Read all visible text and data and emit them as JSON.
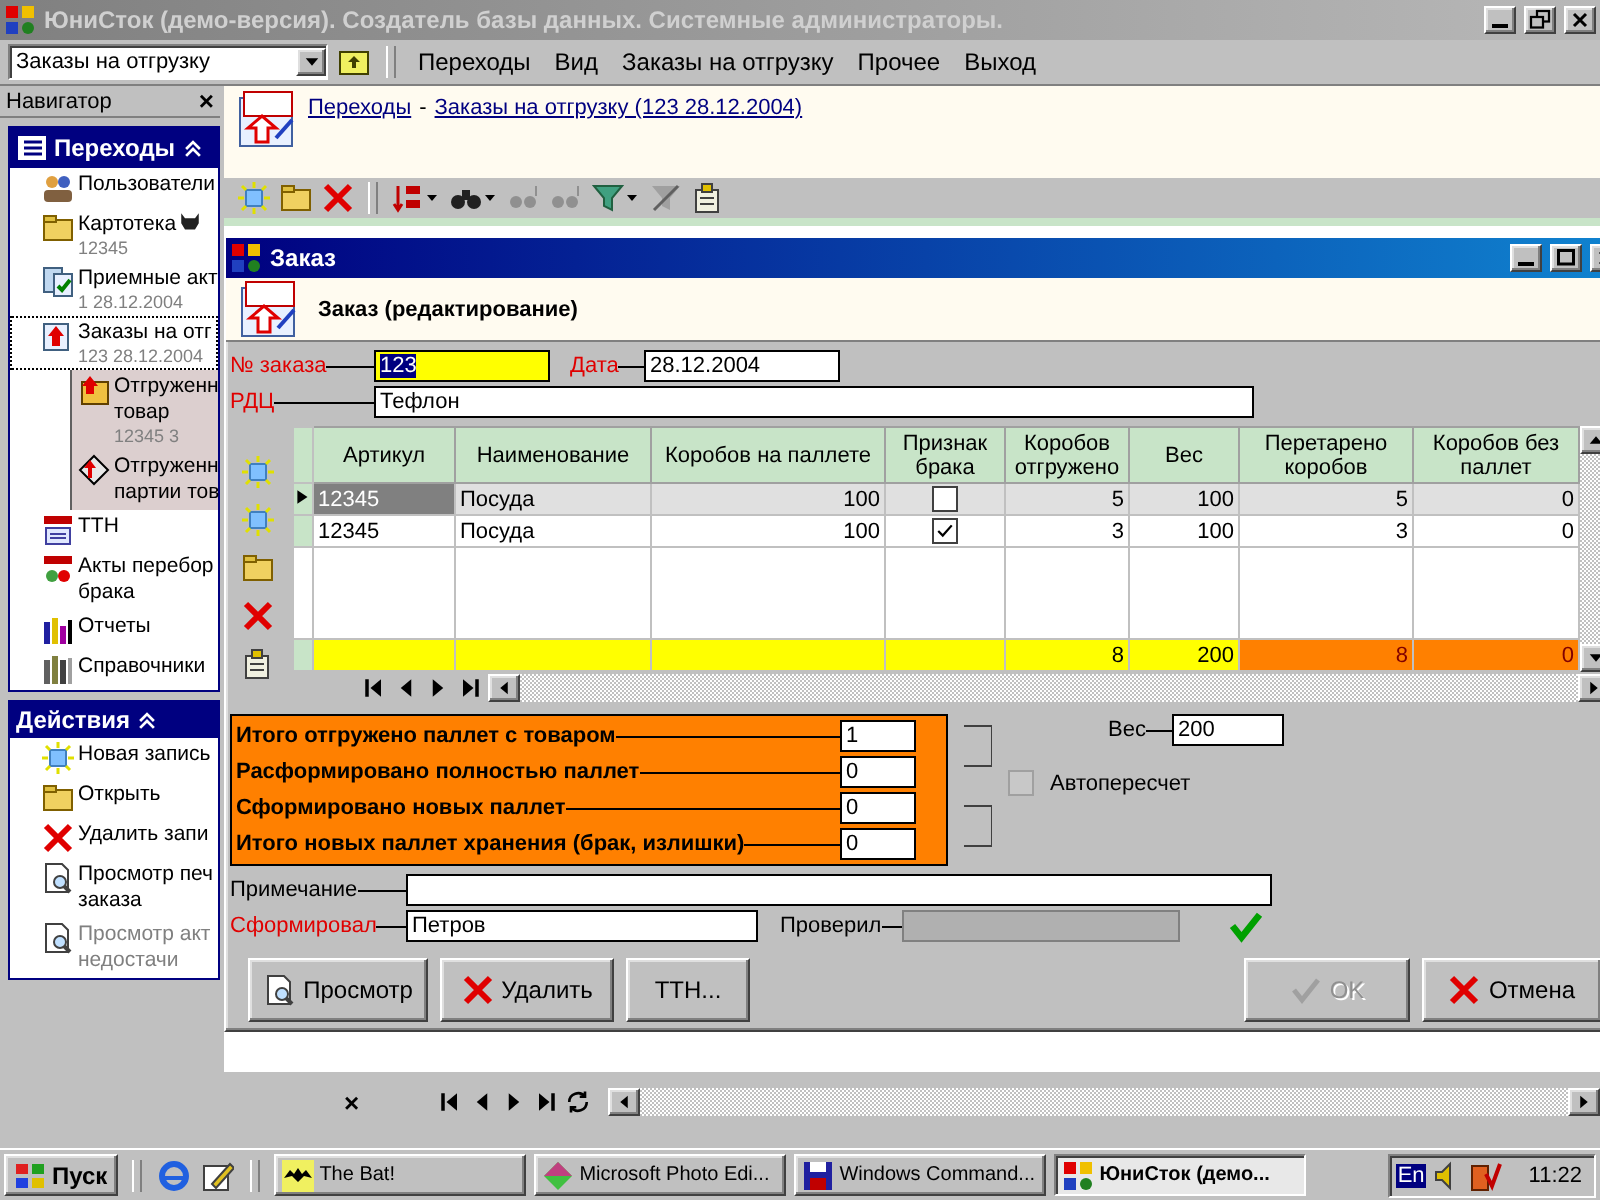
{
  "window": {
    "title": "ЮниСток (демо-версия). Создатель базы данных. Системные администраторы."
  },
  "menubar": {
    "combo": "Заказы на отгрузку",
    "items": [
      "Переходы",
      "Вид",
      "Заказы на отгрузку",
      "Прочее",
      "Выход"
    ]
  },
  "navigator": {
    "title": "Навигатор",
    "close": "×",
    "sections": [
      {
        "title": "Переходы",
        "items": [
          {
            "label": "Пользователи",
            "selected": false
          },
          {
            "label": "Картотека",
            "sub": "12345",
            "marked": true,
            "selected": false
          },
          {
            "label": "Приемные акт",
            "sub": "1 28.12.2004",
            "selected": false
          },
          {
            "label": "Заказы на отг",
            "sub": "123 28.12.2004",
            "selected": true,
            "children": [
              {
                "label": "Отгруженн\nтовар",
                "sub": "12345 3",
                "selected": false
              },
              {
                "label": "Отгруженн\nпартии тов",
                "selected": false
              }
            ]
          },
          {
            "label": "ТТН",
            "selected": false
          },
          {
            "label": "Акты перебор\nбрака",
            "selected": false
          },
          {
            "label": "Отчеты",
            "selected": false
          },
          {
            "label": "Справочники",
            "selected": false
          }
        ]
      },
      {
        "title": "Действия",
        "items": [
          {
            "label": "Новая запись",
            "disabled": false
          },
          {
            "label": "Открыть",
            "disabled": false
          },
          {
            "label": "Удалить запи",
            "disabled": false
          },
          {
            "label": "Просмотр печ\nзаказа",
            "disabled": false
          },
          {
            "label": "Просмотр акт\nнедостачи",
            "disabled": true
          }
        ]
      }
    ]
  },
  "breadcrumb": {
    "links": [
      "Переходы",
      "Заказы на отгрузку (123 28.12.2004)"
    ],
    "separator": "-"
  },
  "main_grid": {
    "close": "×"
  },
  "dialog": {
    "title": "Заказ",
    "heading": "Заказ (редактирование)",
    "order": {
      "label": "№ заказа",
      "value": "123",
      "required": true,
      "value_selected": true
    },
    "date": {
      "label": "Дата",
      "value": "28.12.2004",
      "required": true
    },
    "rdc": {
      "label": "РДЦ",
      "value": "Тефлон",
      "required": true
    },
    "columns": [
      {
        "label": "Артикул",
        "kind": "text"
      },
      {
        "label": "Наименование",
        "kind": "text"
      },
      {
        "label": "Коробов на паллете",
        "kind": "number"
      },
      {
        "label": "Признак брака",
        "kind": "check"
      },
      {
        "label": "Коробов отгружено",
        "kind": "number"
      },
      {
        "label": "Вес",
        "kind": "number"
      },
      {
        "label": "Перетарено коробов",
        "kind": "number"
      },
      {
        "label": "Коробов без паллет",
        "kind": "number"
      }
    ],
    "rows": [
      {
        "cells": [
          "12345",
          "Посуда",
          "100",
          "",
          "5",
          "100",
          "5",
          "0"
        ],
        "defect": false,
        "current": true
      },
      {
        "cells": [
          "12345",
          "Посуда",
          "100",
          "",
          "3",
          "100",
          "3",
          "0"
        ],
        "defect": true,
        "current": false
      }
    ],
    "totals": [
      {
        "color": "#ffff00"
      },
      {
        "color": "#ffff00"
      },
      {
        "color": "#ffff00"
      },
      {
        "color": "#ffff00"
      },
      {
        "value": "8",
        "color": "#ffff00"
      },
      {
        "value": "200",
        "color": "#ffff00"
      },
      {
        "value": "8",
        "color": "#ff8000"
      },
      {
        "value": "0",
        "color": "#ff8000"
      }
    ],
    "pallets": [
      {
        "label": "Итого отгружено паллет с товаром",
        "value": "1"
      },
      {
        "label": "Расформировано полностью паллет",
        "value": "0"
      },
      {
        "label": "Сформировано новых паллет",
        "value": "0"
      },
      {
        "label": "Итого новых паллет хранения (брак, излишки)",
        "value": "0"
      }
    ],
    "weight": {
      "label": "Вес",
      "value": "200"
    },
    "autorecalc": {
      "label": "Автопересчет",
      "checked": false
    },
    "note": {
      "label": "Примечание",
      "required": false
    },
    "formed": {
      "label": "Сформировал",
      "value": "Петров",
      "required": true
    },
    "checked_by": {
      "label": "Проверил",
      "required": false,
      "disabled": true,
      "confirmed": true
    },
    "buttons": [
      {
        "label": "Просмотр",
        "disabled": false
      },
      {
        "label": "Удалить",
        "disabled": false
      },
      {
        "label": "ТТН...",
        "disabled": false
      },
      {
        "label": "OK",
        "disabled": true
      },
      {
        "label": "Отмена",
        "disabled": false
      }
    ]
  },
  "taskbar": {
    "start": "Пуск",
    "tasks": [
      {
        "label": "The Bat!",
        "active": false
      },
      {
        "label": "Microsoft Photo Edi...",
        "active": false
      },
      {
        "label": "Windows Command...",
        "active": false
      },
      {
        "label": "ЮниСток (демо...",
        "active": true
      }
    ],
    "lang": "En",
    "clock": "11:22"
  }
}
